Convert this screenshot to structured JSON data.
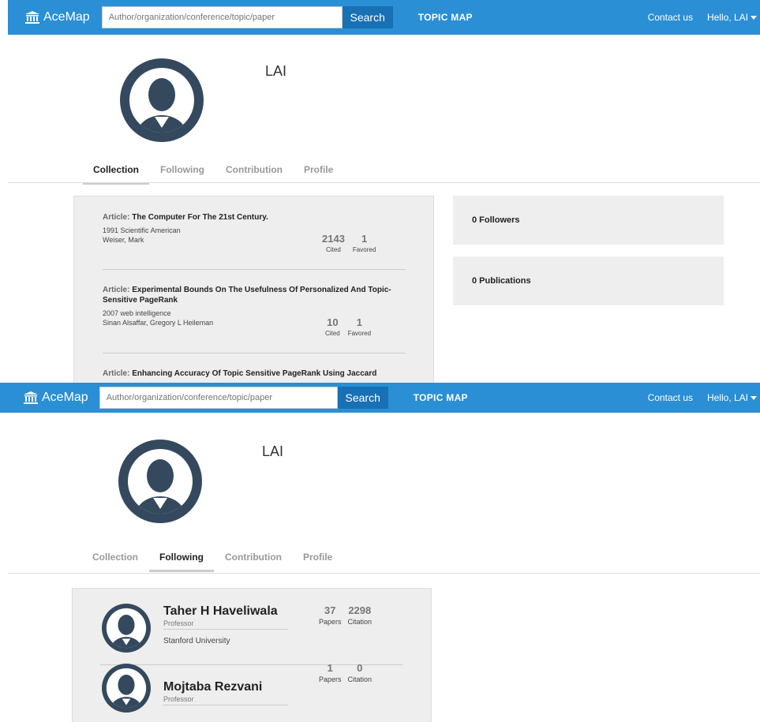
{
  "navbar": {
    "logo_text": "AceMap",
    "search_placeholder": "Author/organization/conference/topic/paper",
    "search_button": "Search",
    "topic_map": "TOPIC MAP",
    "contact": "Contact us",
    "greeting": "Hello, LAI"
  },
  "user": {
    "name": "LAI"
  },
  "tabs": [
    "Collection",
    "Following",
    "Contribution",
    "Profile"
  ],
  "collection": {
    "articles": [
      {
        "label": "Article:",
        "title": "The Computer For The 21st Century.",
        "year": "1991",
        "venue": "Scientific American",
        "authors": "Weiser, Mark",
        "cited": "2143",
        "cited_label": "Cited",
        "favored": "1",
        "favored_label": "Favored"
      },
      {
        "label": "Article:",
        "title": "Experimental Bounds On The Usefulness Of Personalized And Topic-Sensitive PageRank",
        "year": "2007",
        "venue": "web intelligence",
        "authors": "Sinan Alsaffar, Gregory L Heileman",
        "cited": "10",
        "cited_label": "Cited",
        "favored": "1",
        "favored_label": "Favored"
      },
      {
        "label": "Article:",
        "title": "Enhancing Accuracy Of Topic Sensitive PageRank Using Jaccard"
      }
    ],
    "followers": "0 Followers",
    "publications": "0 Publications"
  },
  "following": {
    "people": [
      {
        "name": "Taher H Haveliwala",
        "role": "Professor",
        "org": "Stanford University",
        "papers": "37",
        "papers_label": "Papers",
        "citation": "2298",
        "citation_label": "Citation"
      },
      {
        "name": "Mojtaba Rezvani",
        "role": "Professor",
        "papers": "1",
        "papers_label": "Papers",
        "citation": "0",
        "citation_label": "Citation"
      }
    ]
  },
  "colors": {
    "navbar": "#2a8fd4",
    "search_button": "#1870b5",
    "avatar": "#34495e",
    "panel": "#eeeeee"
  }
}
